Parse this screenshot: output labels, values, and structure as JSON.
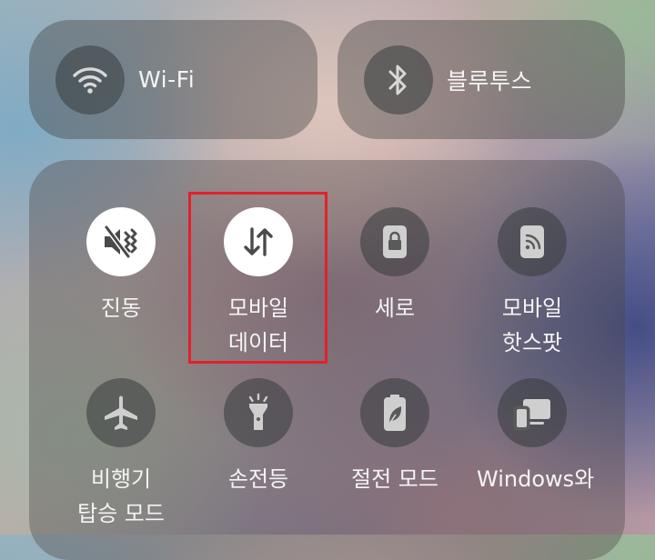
{
  "top_tiles": {
    "wifi": {
      "label": "Wi-Fi",
      "icon": "wifi-icon"
    },
    "bluetooth": {
      "label": "블루투스",
      "icon": "bluetooth-icon"
    }
  },
  "quick_tiles": [
    {
      "label_line1": "진동",
      "label_line2": "",
      "icon": "vibrate-icon",
      "active": true
    },
    {
      "label_line1": "모바일",
      "label_line2": "데이터",
      "icon": "mobile-data-icon",
      "active": true
    },
    {
      "label_line1": "세로",
      "label_line2": "",
      "icon": "portrait-lock-icon",
      "active": false
    },
    {
      "label_line1": "모바일",
      "label_line2": "핫스팟",
      "icon": "mobile-hotspot-icon",
      "active": false
    },
    {
      "label_line1": "비행기",
      "label_line2": "탑승 모드",
      "icon": "airplane-icon",
      "active": false
    },
    {
      "label_line1": "손전등",
      "label_line2": "",
      "icon": "flashlight-icon",
      "active": false
    },
    {
      "label_line1": "절전 모드",
      "label_line2": "",
      "icon": "power-saving-icon",
      "active": false
    },
    {
      "label_line1": "Windows와",
      "label_line2": "",
      "icon": "link-to-windows-icon",
      "active": false
    }
  ],
  "colors": {
    "highlight": "#e3212b",
    "tile_active": "#ffffff",
    "label_text": "#f4f4f4"
  }
}
